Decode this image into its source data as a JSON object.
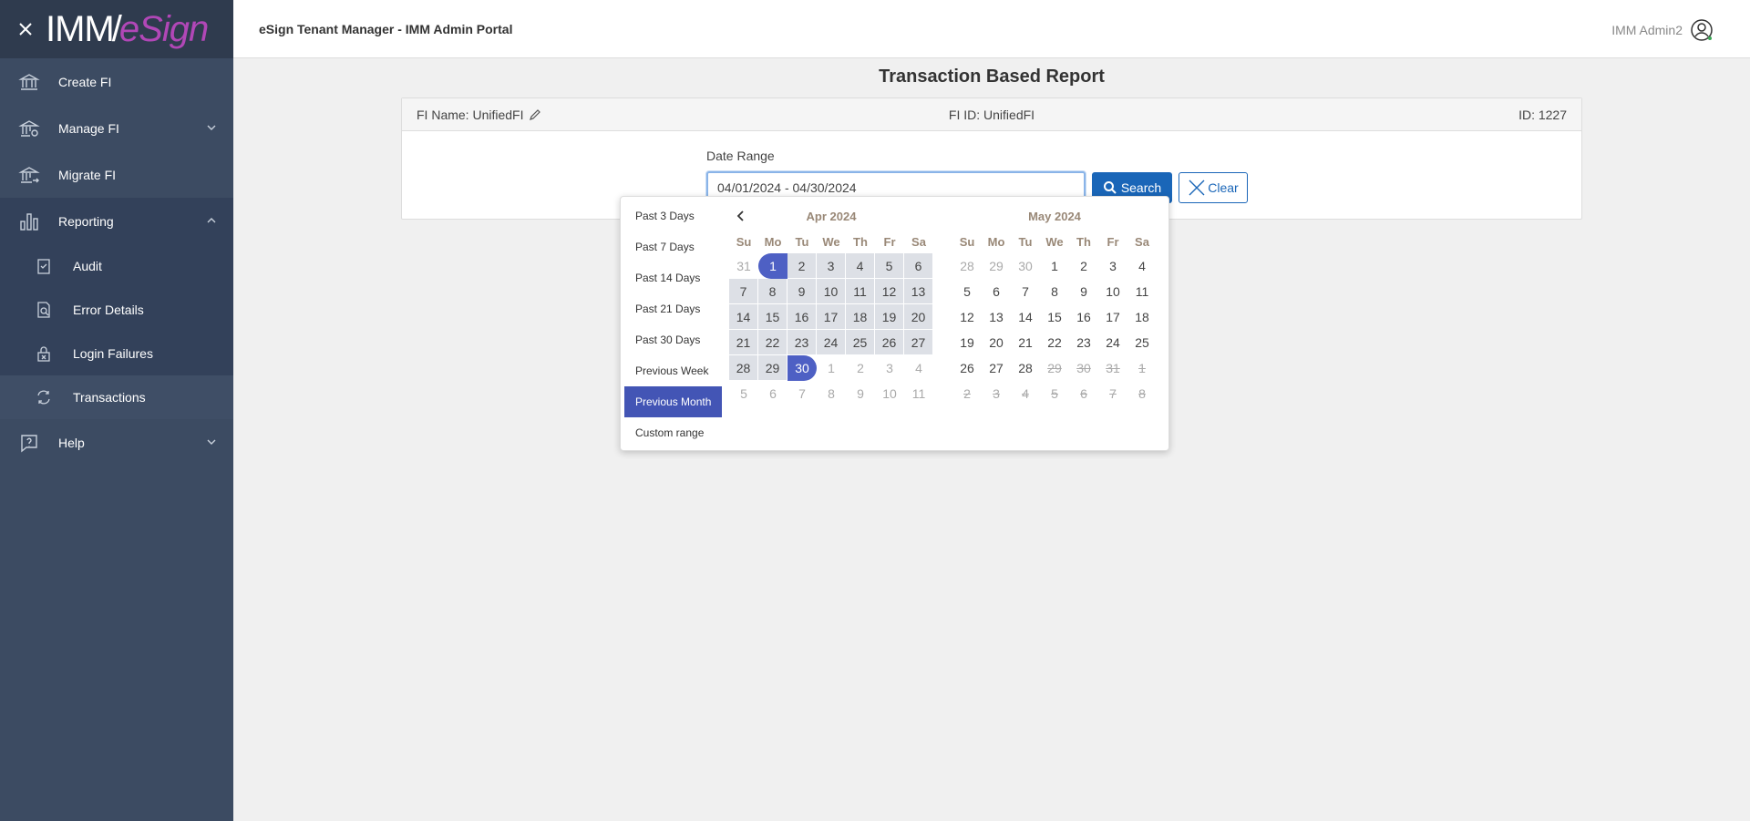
{
  "sidebar": {
    "logo": {
      "part1": "IMM",
      "slash": "/",
      "part2": "eSign"
    },
    "items": [
      {
        "label": "Create FI",
        "icon": "bank-icon"
      },
      {
        "label": "Manage FI",
        "icon": "bank-gear-icon"
      },
      {
        "label": "Migrate FI",
        "icon": "bank-arrow-icon"
      },
      {
        "label": "Reporting",
        "icon": "bar-chart-icon"
      },
      {
        "label": "Help",
        "icon": "help-icon"
      }
    ],
    "reporting_sub": [
      {
        "label": "Audit",
        "icon": "clipboard-check-icon"
      },
      {
        "label": "Error Details",
        "icon": "document-search-icon"
      },
      {
        "label": "Login Failures",
        "icon": "lock-x-icon"
      },
      {
        "label": "Transactions",
        "icon": "transfer-icon"
      }
    ]
  },
  "header": {
    "title": "eSign Tenant Manager - IMM Admin Portal",
    "user_name": "IMM Admin2"
  },
  "main": {
    "page_title": "Transaction Based Report",
    "fi_name": "FI Name: UnifiedFI",
    "fi_id": "FI ID: UnifiedFI",
    "id": "ID: 1227",
    "date_label": "Date Range",
    "date_value": "04/01/2024 - 04/30/2024",
    "search_label": "Search",
    "clear_label": "Clear"
  },
  "picker": {
    "ranges": [
      "Past 3 Days",
      "Past 7 Days",
      "Past 14 Days",
      "Past 21 Days",
      "Past 30 Days",
      "Previous Week",
      "Previous Month",
      "Custom range"
    ],
    "active_range": "Previous Month",
    "weekdays": [
      "Su",
      "Mo",
      "Tu",
      "We",
      "Th",
      "Fr",
      "Sa"
    ],
    "left": {
      "month": "Apr 2024",
      "weeks": [
        [
          {
            "d": "31",
            "s": "off"
          },
          {
            "d": "1",
            "s": "start"
          },
          {
            "d": "2",
            "s": "inrange"
          },
          {
            "d": "3",
            "s": "inrange"
          },
          {
            "d": "4",
            "s": "inrange"
          },
          {
            "d": "5",
            "s": "inrange"
          },
          {
            "d": "6",
            "s": "inrange"
          }
        ],
        [
          {
            "d": "7",
            "s": "inrange"
          },
          {
            "d": "8",
            "s": "inrange"
          },
          {
            "d": "9",
            "s": "inrange"
          },
          {
            "d": "10",
            "s": "inrange"
          },
          {
            "d": "11",
            "s": "inrange"
          },
          {
            "d": "12",
            "s": "inrange"
          },
          {
            "d": "13",
            "s": "inrange"
          }
        ],
        [
          {
            "d": "14",
            "s": "inrange"
          },
          {
            "d": "15",
            "s": "inrange"
          },
          {
            "d": "16",
            "s": "inrange"
          },
          {
            "d": "17",
            "s": "inrange"
          },
          {
            "d": "18",
            "s": "inrange"
          },
          {
            "d": "19",
            "s": "inrange"
          },
          {
            "d": "20",
            "s": "inrange"
          }
        ],
        [
          {
            "d": "21",
            "s": "inrange"
          },
          {
            "d": "22",
            "s": "inrange"
          },
          {
            "d": "23",
            "s": "inrange"
          },
          {
            "d": "24",
            "s": "inrange"
          },
          {
            "d": "25",
            "s": "inrange"
          },
          {
            "d": "26",
            "s": "inrange"
          },
          {
            "d": "27",
            "s": "inrange"
          }
        ],
        [
          {
            "d": "28",
            "s": "inrange"
          },
          {
            "d": "29",
            "s": "inrange"
          },
          {
            "d": "30",
            "s": "end"
          },
          {
            "d": "1",
            "s": "off"
          },
          {
            "d": "2",
            "s": "off"
          },
          {
            "d": "3",
            "s": "off"
          },
          {
            "d": "4",
            "s": "off"
          }
        ],
        [
          {
            "d": "5",
            "s": "off"
          },
          {
            "d": "6",
            "s": "off"
          },
          {
            "d": "7",
            "s": "off"
          },
          {
            "d": "8",
            "s": "off"
          },
          {
            "d": "9",
            "s": "off"
          },
          {
            "d": "10",
            "s": "off"
          },
          {
            "d": "11",
            "s": "off"
          }
        ]
      ]
    },
    "right": {
      "month": "May 2024",
      "weeks": [
        [
          {
            "d": "28",
            "s": "off"
          },
          {
            "d": "29",
            "s": "off"
          },
          {
            "d": "30",
            "s": "off"
          },
          {
            "d": "1",
            "s": ""
          },
          {
            "d": "2",
            "s": ""
          },
          {
            "d": "3",
            "s": ""
          },
          {
            "d": "4",
            "s": ""
          }
        ],
        [
          {
            "d": "5",
            "s": ""
          },
          {
            "d": "6",
            "s": ""
          },
          {
            "d": "7",
            "s": ""
          },
          {
            "d": "8",
            "s": ""
          },
          {
            "d": "9",
            "s": ""
          },
          {
            "d": "10",
            "s": ""
          },
          {
            "d": "11",
            "s": ""
          }
        ],
        [
          {
            "d": "12",
            "s": ""
          },
          {
            "d": "13",
            "s": ""
          },
          {
            "d": "14",
            "s": ""
          },
          {
            "d": "15",
            "s": ""
          },
          {
            "d": "16",
            "s": ""
          },
          {
            "d": "17",
            "s": ""
          },
          {
            "d": "18",
            "s": ""
          }
        ],
        [
          {
            "d": "19",
            "s": ""
          },
          {
            "d": "20",
            "s": ""
          },
          {
            "d": "21",
            "s": ""
          },
          {
            "d": "22",
            "s": ""
          },
          {
            "d": "23",
            "s": ""
          },
          {
            "d": "24",
            "s": ""
          },
          {
            "d": "25",
            "s": ""
          }
        ],
        [
          {
            "d": "26",
            "s": ""
          },
          {
            "d": "27",
            "s": ""
          },
          {
            "d": "28",
            "s": ""
          },
          {
            "d": "29",
            "s": "strike"
          },
          {
            "d": "30",
            "s": "strike"
          },
          {
            "d": "31",
            "s": "strike"
          },
          {
            "d": "1",
            "s": "strike"
          }
        ],
        [
          {
            "d": "2",
            "s": "strike"
          },
          {
            "d": "3",
            "s": "strike"
          },
          {
            "d": "4",
            "s": "strike"
          },
          {
            "d": "5",
            "s": "strike"
          },
          {
            "d": "6",
            "s": "strike"
          },
          {
            "d": "7",
            "s": "strike"
          },
          {
            "d": "8",
            "s": "strike"
          }
        ]
      ]
    }
  },
  "colors": {
    "sidebar_bg": "#3c4b62",
    "accent": "#4355b5",
    "button_blue": "#1a66b8",
    "logo_esign": "#b147b7"
  }
}
